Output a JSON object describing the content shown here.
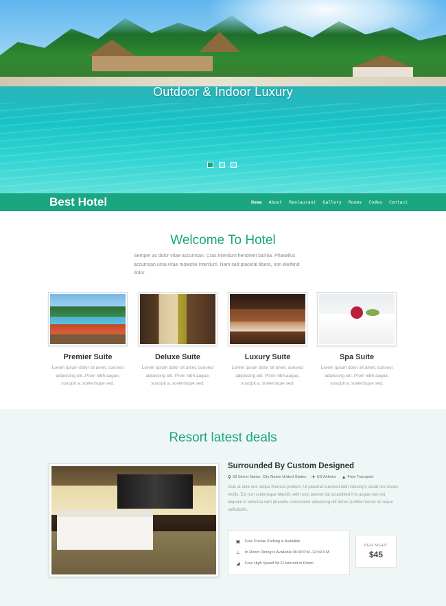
{
  "hero": {
    "caption": "Outdoor & Indoor Luxury",
    "slides": [
      "slide-1",
      "slide-2",
      "slide-3"
    ],
    "active_slide": 1
  },
  "nav": {
    "brand": "Best Hotel",
    "links": [
      "Home",
      "About",
      "Restaurant",
      "Gallery",
      "Rooms",
      "Codes",
      "Contact"
    ],
    "active": "Home"
  },
  "welcome": {
    "title": "Welcome To Hotel",
    "text": "Semper ac dolor vitae accumsan. Cras interdum hendrerit lacinia. Phasellus accumsan urna vitae molestie interdum. Nam sed placerat libero, non eleifend dolor."
  },
  "suites": [
    {
      "name": "Premier Suite",
      "desc": "Lorem ipsum dolor sit amet, consect adipiscing elit. Proin nibh augue, suscipit a, scelerisque sed."
    },
    {
      "name": "Deluxe Suite",
      "desc": "Lorem ipsum dolor sit amet, consect adipiscing elit. Proin nibh augue, suscipit a, scelerisque sed."
    },
    {
      "name": "Luxury Suite",
      "desc": "Lorem ipsum dolor sit amet, consect adipiscing elit. Proin nibh augue, suscipit a, scelerisque sed."
    },
    {
      "name": "Spa Suite",
      "desc": "Lorem ipsum dolor sit amet, consect adipiscing elit. Proin nibh augue, suscipit a, scelerisque sed."
    }
  ],
  "deals": {
    "title": "Resort latest deals",
    "heading": "Surrounded By Custom Designed",
    "meta": {
      "address": "33 Street Name, City Name United States",
      "airline": "US Airlines",
      "transport": "Free Transport"
    },
    "desc": "Duis at ante nec neque rhoncus pretium. Ut placerat euismod nibh industry's stand orci donec mollis. Est non scelerisque blandit, velit nunc laoreet dui scrambled it to augue non est aliquam in vehicula sem phasellu consectetur adipiscing elit donec porttitor lectus at neque sollicitudin.",
    "amenities": [
      {
        "icon": "car-icon",
        "label": "Free Private Parking is Available"
      },
      {
        "icon": "dining-icon",
        "label": "In Room Dining is Available 06:00 P.M.-12:09 P.M."
      },
      {
        "icon": "wifi-icon",
        "label": "Free High Speed Wi-Fi Internet in Room"
      }
    ],
    "price_label": "PER NIGHT",
    "price": "$45"
  },
  "colors": {
    "accent": "#1aa680",
    "deals_bg": "#eef7f5"
  }
}
